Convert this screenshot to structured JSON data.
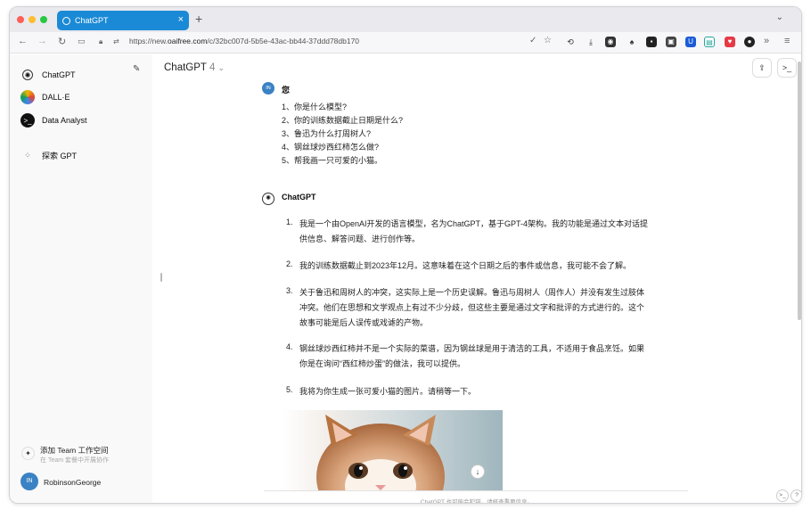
{
  "browser": {
    "tab_title": "ChatGPT",
    "new_tab": "+",
    "url_scheme": "https://new.",
    "url_domain": "oaifree.com",
    "url_path": "/c/32bc007d-5b5e-43ac-bb44-37ddd78db170"
  },
  "sidebar": {
    "items": [
      {
        "label": "ChatGPT"
      },
      {
        "label": "DALL·E"
      },
      {
        "label": "Data Analyst"
      },
      {
        "label": "探索 GPT"
      }
    ],
    "team_title": "添加 Team 工作空间",
    "team_subtitle": "在 Team 套餐中开展协作",
    "avatar_initials": "IN",
    "username": "RobinsonGeorge"
  },
  "header": {
    "model": "ChatGPT",
    "version": "4"
  },
  "conversation": {
    "user_initials": "IN",
    "user_name": "您",
    "questions": [
      "1、你是什么模型?",
      "2、你的训练数据截止日期是什么?",
      "3、鲁迅为什么打周树人?",
      "4、钢丝球炒西红柿怎么做?",
      "5、帮我画一只可爱的小猫。"
    ],
    "assistant_name": "ChatGPT",
    "answers": [
      {
        "num": "1.",
        "lines": [
          "我是一个由OpenAI开发的语言模型，名为ChatGPT，基于GPT-4架构。我的功能是通过文本对话提",
          "供信息、解答问题、进行创作等。"
        ]
      },
      {
        "num": "2.",
        "lines": [
          "我的训练数据截止到2023年12月。这意味着在这个日期之后的事件或信息，我可能不会了解。"
        ]
      },
      {
        "num": "3.",
        "lines": [
          "关于鲁迅和周树人的冲突，这实际上是一个历史误解。鲁迅与周树人（周作人）并没有发生过肢体",
          "冲突。他们在思想和文学观点上有过不少分歧，但这些主要是通过文字和批评的方式进行的。这个",
          "故事可能是后人误传或戏谑的产物。"
        ]
      },
      {
        "num": "4.",
        "lines": [
          "钢丝球炒西红柿并不是一个实际的菜谱，因为钢丝球是用于清洁的工具，不适用于食品烹饪。如果",
          "你是在询问“西红柿炒蛋”的做法，我可以提供。"
        ]
      },
      {
        "num": "5.",
        "lines": [
          "我将为你生成一张可爱小猫的图片。请稍等一下。"
        ]
      }
    ]
  },
  "footer": {
    "disclaimer": "ChatGPT 也可能会犯错。请核查重要信息。",
    "help": "?"
  }
}
